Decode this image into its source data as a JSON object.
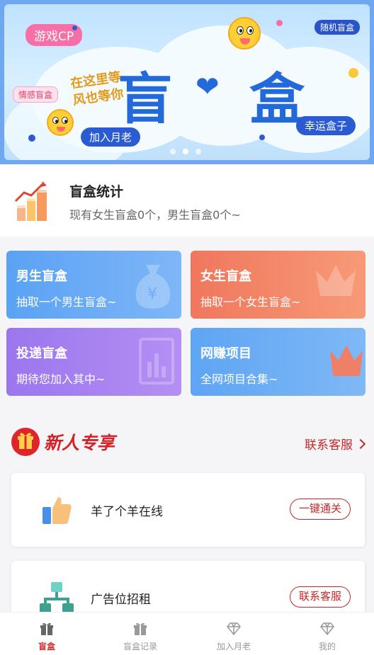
{
  "banner": {
    "tag_game": "游戏CP",
    "tag_random": "随机盲盒",
    "tag_emotion": "情感盲盒",
    "script_text": "在这里等风也等你",
    "title_left": "盲",
    "title_right": "盒",
    "tag_join": "加入月老",
    "tag_lucky": "幸运盒子",
    "pages": 3,
    "active_page": 2
  },
  "stats": {
    "title": "盲盒统计",
    "subtitle": "现有女生盲盒0个，男生盲盒0个~"
  },
  "cards": [
    {
      "title": "男生盲盒",
      "sub": "抽取一个男生盲盒~"
    },
    {
      "title": "女生盲盒",
      "sub": "抽取一个女生盲盒~"
    },
    {
      "title": "投递盲盒",
      "sub": "期待您加入其中~"
    },
    {
      "title": "网赚项目",
      "sub": "全网项目合集~"
    }
  ],
  "section": {
    "title": "新人专享",
    "contact": "联系客服"
  },
  "list": [
    {
      "label": "羊了个羊在线",
      "action": "一键通关"
    },
    {
      "label": "广告位招租",
      "action": "联系客服"
    }
  ],
  "tabs": [
    {
      "label": "盲盒",
      "icon": "gift-icon",
      "active": true
    },
    {
      "label": "盲盒记录",
      "icon": "gift-icon",
      "active": false
    },
    {
      "label": "加入月老",
      "icon": "diamond-icon",
      "active": false
    },
    {
      "label": "我的",
      "icon": "diamond-icon",
      "active": false
    }
  ],
  "colors": {
    "accent": "#d32f2f",
    "banner_blue": "#2469d9",
    "card_male": "#59a2f4",
    "card_female": "#f0775d",
    "card_post": "#9b76ee",
    "card_earn": "#5ea5f3"
  }
}
